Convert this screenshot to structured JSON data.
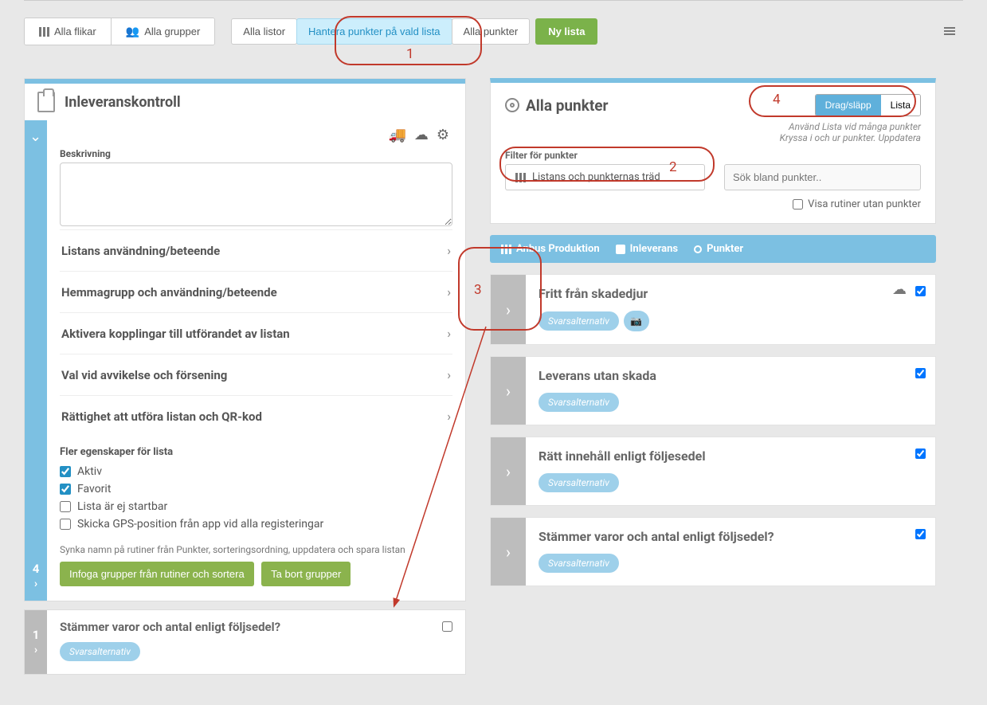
{
  "topbar": {
    "selectors": {
      "all_tabs": "Alla flikar",
      "all_groups": "Alla grupper"
    },
    "tabs": {
      "alla_listor": "Alla listor",
      "hantera": "Hantera punkter på vald lista",
      "alla_punkter": "Alla punkter"
    },
    "new_list": "Ny lista"
  },
  "left": {
    "title": "Inleveranskontroll",
    "desc_label": "Beskrivning",
    "desc_value": "",
    "acc": {
      "anv": "Listans användning/beteende",
      "hemma": "Hemmagrupp och användning/beteende",
      "aktivera": "Aktivera kopplingar till utförandet av listan",
      "val": "Val vid avvikelse och försening",
      "ratt": "Rättighet att utföra listan och QR-kod"
    },
    "more_props": "Fler egenskaper för lista",
    "cb": {
      "aktiv": {
        "label": "Aktiv",
        "checked": true
      },
      "favorit": {
        "label": "Favorit",
        "checked": true
      },
      "startbar": {
        "label": "Lista är ej startbar",
        "checked": false
      },
      "gps": {
        "label": "Skicka GPS-position från app vid alla registeringar",
        "checked": false
      }
    },
    "sync_note": "Synka namn på rutiner från Punkter, sorteringsordning, uppdatera och spara listan",
    "btn_infoga": "Infoga grupper från rutiner och sortera",
    "btn_tabort": "Ta bort grupper",
    "handle4": "4",
    "item1": {
      "num": "1",
      "title": "Stämmer varor och antal enligt följsedel?",
      "pill": "Svarsalternativ",
      "checked": false
    }
  },
  "right": {
    "title": "Alla punkter",
    "seg": {
      "drag": "Drag/släpp",
      "lista": "Lista"
    },
    "hint1": "Använd Lista vid många punkter",
    "hint2": "Kryssa i och ur punkter. Uppdatera",
    "filter_label": "Filter för punkter",
    "tree": "Listans och punkternas träd",
    "search_placeholder": "Sök bland punkter..",
    "visa": "Visa rutiner utan punkter",
    "crumb": {
      "a": "Anbus Produktion",
      "b": "Inleverans",
      "c": "Punkter"
    },
    "items": [
      {
        "title": "Fritt från skadedjur",
        "pill": "Svarsalternativ",
        "checked": true,
        "cam": true,
        "tree_icon": true
      },
      {
        "title": "Leverans utan skada",
        "pill": "Svarsalternativ",
        "checked": true,
        "cam": false,
        "tree_icon": false
      },
      {
        "title": "Rätt innehåll enligt följesedel",
        "pill": "Svarsalternativ",
        "checked": true,
        "cam": false,
        "tree_icon": false
      },
      {
        "title": "Stämmer varor och antal enligt följsedel?",
        "pill": "Svarsalternativ",
        "checked": true,
        "cam": false,
        "tree_icon": false
      }
    ]
  },
  "annotations": {
    "n1": "1",
    "n2": "2",
    "n3": "3",
    "n4": "4"
  }
}
